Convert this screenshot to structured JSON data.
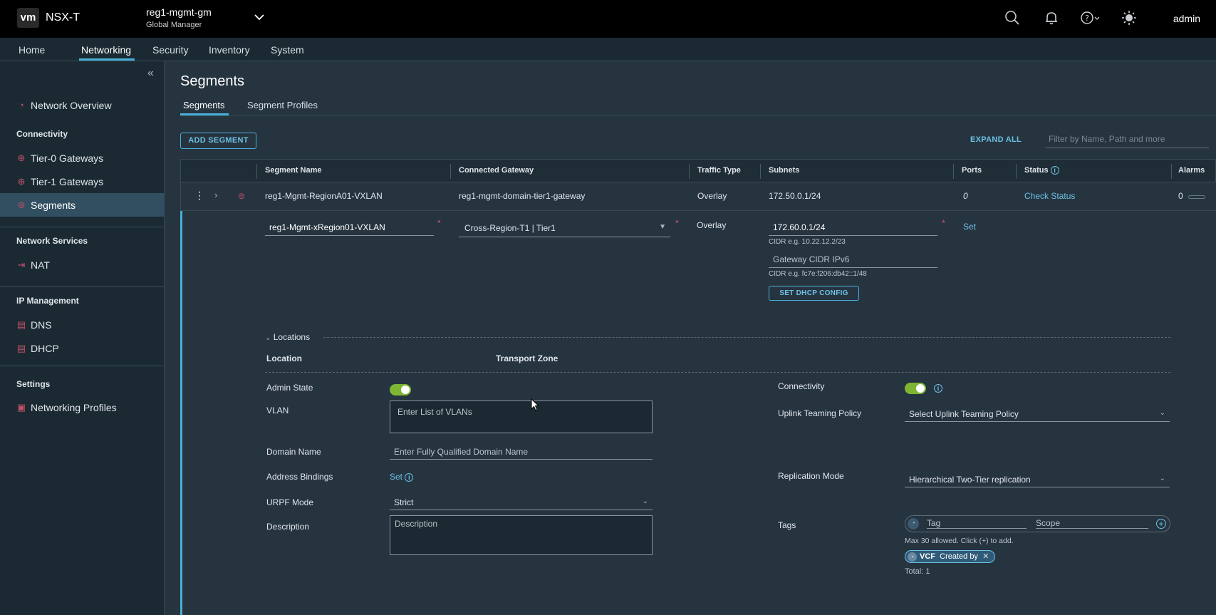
{
  "header": {
    "logo": "vm",
    "app_name": "NSX-T",
    "manager_title": "reg1-mgmt-gm",
    "manager_subtitle": "Global Manager",
    "user": "admin",
    "icons": [
      "search-icon",
      "bell-icon",
      "help-icon",
      "sun-icon"
    ]
  },
  "nav": {
    "items": [
      "Home",
      "Networking",
      "Security",
      "Inventory",
      "System"
    ],
    "active": "Networking"
  },
  "sidebar": {
    "network_overview": "Network Overview",
    "connectivity_header": "Connectivity",
    "tier0": "Tier-0 Gateways",
    "tier1": "Tier-1 Gateways",
    "segments": "Segments",
    "network_services_header": "Network Services",
    "nat": "NAT",
    "ip_management_header": "IP Management",
    "dns": "DNS",
    "dhcp": "DHCP",
    "settings_header": "Settings",
    "networking_profiles": "Networking Profiles"
  },
  "page": {
    "title": "Segments",
    "tabs": [
      "Segments",
      "Segment Profiles"
    ],
    "add_button": "ADD SEGMENT",
    "expand_all": "EXPAND ALL",
    "filter_placeholder": "Filter by Name, Path and more"
  },
  "table": {
    "columns": [
      "Segment Name",
      "Connected Gateway",
      "Traffic Type",
      "Subnets",
      "Ports",
      "Status",
      "Alarms"
    ],
    "row": {
      "name": "reg1-Mgmt-RegionA01-VXLAN",
      "gateway": "reg1-mgmt-domain-tier1-gateway",
      "traffic": "Overlay",
      "subnet": "172.50.0.1/24",
      "ports": "0",
      "status": "Check Status",
      "alarms": "0"
    }
  },
  "edit": {
    "name_value": "reg1-Mgmt-xRegion01-VXLAN",
    "gateway_value": "Cross-Region-T1 | Tier1",
    "traffic": "Overlay",
    "subnet_value": "172.60.0.1/24",
    "subnet_hint": "CIDR e.g. 10.22.12.2/23",
    "ipv6_placeholder": "Gateway CIDR IPv6",
    "ipv6_hint": "CIDR e.g. fc7e:f206:db42::1/48",
    "set_link": "Set",
    "dhcp_button": "SET DHCP CONFIG",
    "locations_label": "Locations",
    "location_col": "Location",
    "transport_zone_col": "Transport Zone",
    "admin_state_label": "Admin State",
    "admin_state_on": true,
    "vlan_label": "VLAN",
    "vlan_placeholder": "Enter List of VLANs",
    "domain_label": "Domain Name",
    "domain_placeholder": "Enter Fully Qualified Domain Name",
    "address_bindings_label": "Address Bindings",
    "address_bindings_link": "Set",
    "urpf_label": "URPF Mode",
    "urpf_value": "Strict",
    "description_label": "Description",
    "description_placeholder": "Description",
    "connectivity_label": "Connectivity",
    "connectivity_on": true,
    "uplink_label": "Uplink Teaming Policy",
    "uplink_placeholder": "Select Uplink Teaming Policy",
    "replication_label": "Replication Mode",
    "replication_value": "Hierarchical Two-Tier replication",
    "tags_label": "Tags",
    "tag_placeholder": "Tag",
    "scope_placeholder": "Scope",
    "tag_hint": "Max 30 allowed. Click (+) to add.",
    "tag_chip_tag": "VCF",
    "tag_chip_scope": "Created by",
    "tag_total": "Total: 1"
  },
  "colors": {
    "accent": "#49afd9",
    "toggle_on": "#7eb533",
    "required": "#e0506a"
  }
}
